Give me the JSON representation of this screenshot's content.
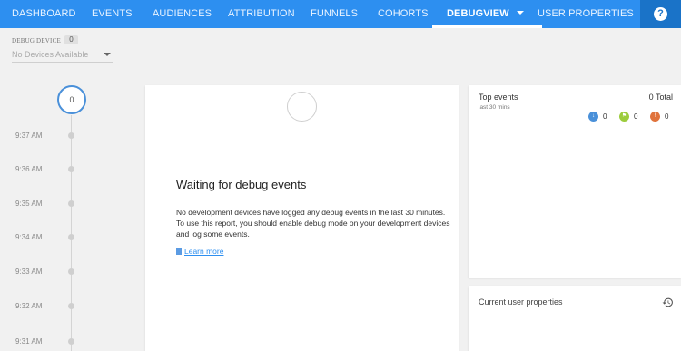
{
  "nav": {
    "items": [
      {
        "label": "DASHBOARD"
      },
      {
        "label": "EVENTS"
      },
      {
        "label": "AUDIENCES"
      },
      {
        "label": "ATTRIBUTION"
      },
      {
        "label": "FUNNELS"
      },
      {
        "label": "COHORTS"
      },
      {
        "label": "DEBUGVIEW",
        "active": true
      },
      {
        "label": "USER PROPERTIES"
      }
    ],
    "help_label": "?",
    "accent_color": "#2d8ff0"
  },
  "debug_device": {
    "label": "DEBUG DEVICE",
    "count": "0",
    "selected": "No Devices Available"
  },
  "timeline": {
    "event_count": "0",
    "times": [
      "9:37 AM",
      "9:36 AM",
      "9:35 AM",
      "9:34 AM",
      "9:33 AM",
      "9:32 AM",
      "9:31 AM"
    ]
  },
  "main": {
    "title": "Waiting for debug events",
    "body": "No development devices have logged any debug events in the last 30 minutes. To use this report, you should enable debug mode on your development devices and log some events.",
    "learn_more": "Learn more"
  },
  "top_events": {
    "title": "Top events",
    "subtitle": "last 30 mins",
    "total": "0 Total",
    "stats": [
      {
        "icon": "info-icon",
        "value": "0",
        "color": "#4a90d9"
      },
      {
        "icon": "flag-icon",
        "value": "0",
        "color": "#9ccc3c"
      },
      {
        "icon": "error-icon",
        "value": "0",
        "color": "#e0733c"
      }
    ]
  },
  "user_properties": {
    "title": "Current user properties",
    "icon": "history-icon"
  }
}
